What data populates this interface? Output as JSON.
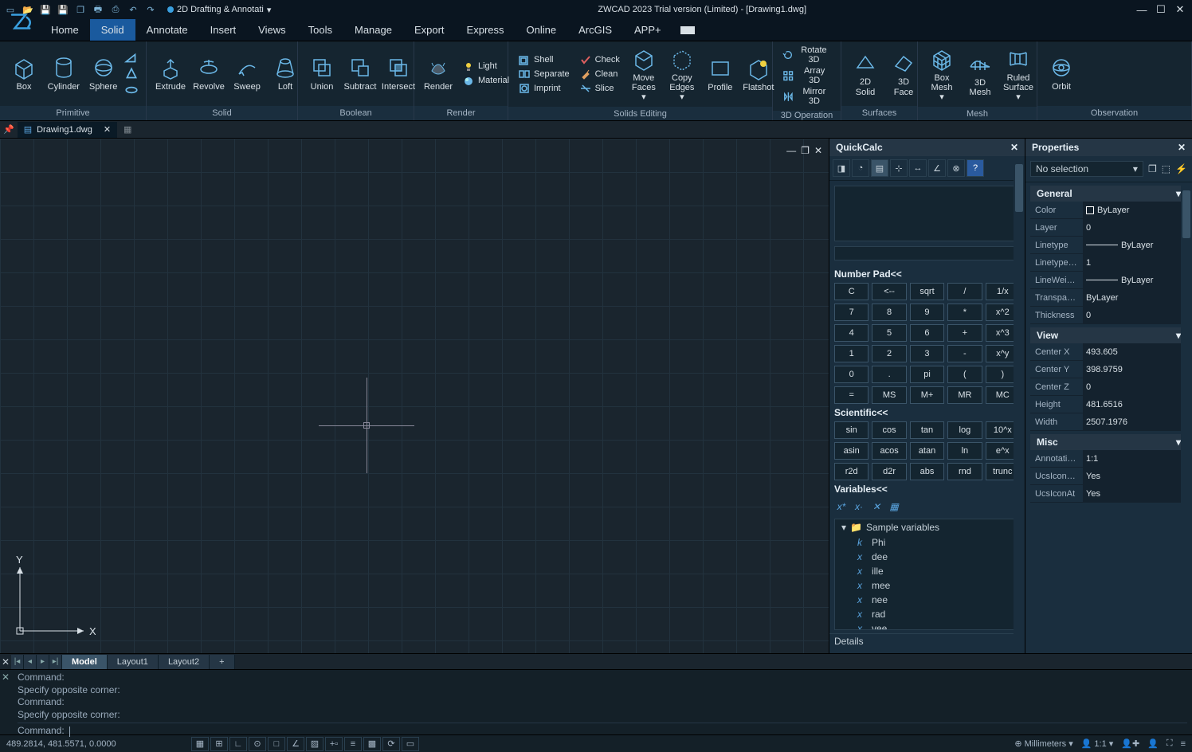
{
  "title": "ZWCAD 2023 Trial version (Limited) - [Drawing1.dwg]",
  "workspace": "2D Drafting & Annotati",
  "menus": [
    "Home",
    "Solid",
    "Annotate",
    "Insert",
    "Views",
    "Tools",
    "Manage",
    "Export",
    "Express",
    "Online",
    "ArcGIS",
    "APP+"
  ],
  "menu_active": 1,
  "ribbon": {
    "groups": [
      {
        "label": "Primitive",
        "items": [
          "Box",
          "Cylinder",
          "Sphere"
        ]
      },
      {
        "label": "Solid",
        "items": [
          "Extrude",
          "Revolve",
          "Sweep",
          "Loft"
        ]
      },
      {
        "label": "Boolean",
        "items": [
          "Union",
          "Subtract",
          "Intersect"
        ]
      },
      {
        "label": "Render",
        "items": [
          "Render"
        ],
        "side": [
          "Light",
          "Material"
        ]
      },
      {
        "label": "Solids Editing",
        "cols": [
          [
            "Shell",
            "Separate",
            "Imprint"
          ],
          [
            "Check",
            "Clean",
            "Slice"
          ]
        ],
        "items": [
          "Move Faces",
          "Copy Edges",
          "Profile",
          "Flatshot"
        ]
      },
      {
        "label": "3D Operation",
        "side": [
          "Rotate 3D",
          "Array 3D",
          "Mirror 3D"
        ]
      },
      {
        "label": "Surfaces",
        "items": [
          "2D Solid",
          "3D Face"
        ]
      },
      {
        "label": "Mesh",
        "items": [
          "Box Mesh",
          "3D Mesh",
          "Ruled Surface"
        ]
      },
      {
        "label": "Observation",
        "items": [
          "Orbit"
        ]
      }
    ]
  },
  "doc_tab": "Drawing1.dwg",
  "quickcalc": {
    "title": "QuickCalc",
    "numpad_label": "Number Pad<<",
    "numpad": [
      "C",
      "<--",
      "sqrt",
      "/",
      "1/x",
      "7",
      "8",
      "9",
      "*",
      "x^2",
      "4",
      "5",
      "6",
      "+",
      "x^3",
      "1",
      "2",
      "3",
      "-",
      "x^y",
      "0",
      ".",
      "pi",
      "(",
      ")",
      "=",
      "MS",
      "M+",
      "MR",
      "MC"
    ],
    "sci_label": "Scientific<<",
    "sci": [
      "sin",
      "cos",
      "tan",
      "log",
      "10^x",
      "asin",
      "acos",
      "atan",
      "ln",
      "e^x",
      "r2d",
      "d2r",
      "abs",
      "rnd",
      "trunc"
    ],
    "var_label": "Variables<<",
    "var_folder": "Sample variables",
    "vars": [
      [
        "k",
        "Phi"
      ],
      [
        "x",
        "dee"
      ],
      [
        "x",
        "ille"
      ],
      [
        "x",
        "mee"
      ],
      [
        "x",
        "nee"
      ],
      [
        "x",
        "rad"
      ],
      [
        "x",
        "vee"
      ]
    ],
    "details": "Details"
  },
  "properties": {
    "title": "Properties",
    "selection": "No selection",
    "general": {
      "label": "General",
      "rows": [
        [
          "Color",
          "ByLayer",
          "sw"
        ],
        [
          "Layer",
          "0",
          ""
        ],
        [
          "Linetype",
          "ByLayer",
          "line"
        ],
        [
          "LinetypeS...",
          "1",
          ""
        ],
        [
          "LineWeight",
          "ByLayer",
          "line"
        ],
        [
          "Transpare...",
          "ByLayer",
          ""
        ],
        [
          "Thickness",
          "0",
          ""
        ]
      ]
    },
    "view": {
      "label": "View",
      "rows": [
        [
          "Center X",
          "493.605",
          ""
        ],
        [
          "Center Y",
          "398.9759",
          ""
        ],
        [
          "Center Z",
          "0",
          ""
        ],
        [
          "Height",
          "481.6516",
          ""
        ],
        [
          "Width",
          "2507.1976",
          ""
        ]
      ]
    },
    "misc": {
      "label": "Misc",
      "rows": [
        [
          "Annotatio...",
          "1:1",
          ""
        ],
        [
          "UcsIconOn",
          "Yes",
          ""
        ],
        [
          "UcsIconAt",
          "Yes",
          ""
        ]
      ]
    }
  },
  "layouts": {
    "active": 0,
    "tabs": [
      "Model",
      "Layout1",
      "Layout2"
    ]
  },
  "command": {
    "history": [
      "Command:",
      "Specify opposite corner:",
      "Command:",
      "Specify opposite corner:"
    ],
    "prompt": "Command:"
  },
  "status": {
    "coords": "489.2814, 481.5571, 0.0000",
    "units": "Millimeters",
    "scale": "1:1"
  }
}
